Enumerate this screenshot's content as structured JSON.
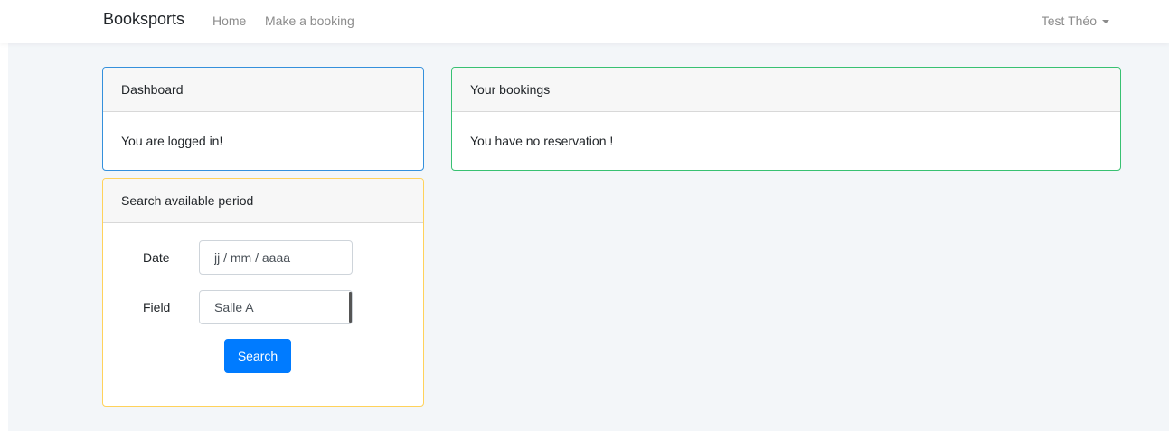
{
  "navbar": {
    "brand": "Booksports",
    "links": [
      {
        "label": "Home"
      },
      {
        "label": "Make a booking"
      }
    ],
    "user": "Test Théo"
  },
  "dashboard": {
    "header": "Dashboard",
    "message": "You are logged in!"
  },
  "bookings": {
    "header": "Your bookings",
    "message": "You have no reservation !"
  },
  "search": {
    "header": "Search available period",
    "date_label": "Date",
    "date_placeholder": "jj / mm / aaaa",
    "field_label": "Field",
    "field_selected": "Salle A",
    "button_label": "Search"
  },
  "colors": {
    "dashboard_border": "#3490dc",
    "bookings_border": "#38c172",
    "search_border": "#ffd25b",
    "primary_button": "#007bff",
    "page_background": "#f3f6f9"
  },
  "icons": {
    "user_menu": "caret-down-icon"
  }
}
